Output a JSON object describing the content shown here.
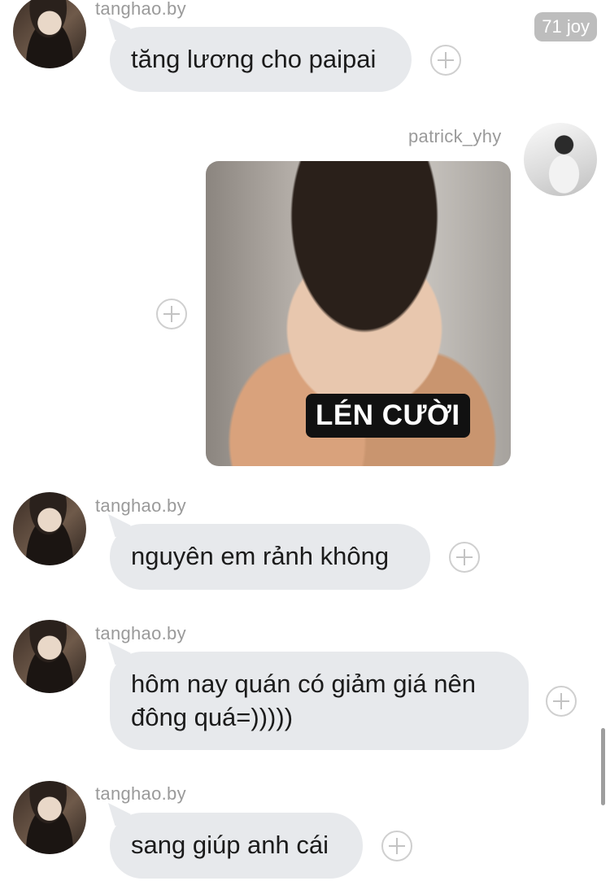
{
  "badge": "71 joy",
  "caption_text": "LÉN CƯỜI",
  "messages": [
    {
      "user": "tanghao.by",
      "text": "tăng lương cho paipai"
    },
    {
      "user": "patrick_yhy"
    },
    {
      "user": "tanghao.by",
      "text": "nguyên em rảnh không"
    },
    {
      "user": "tanghao.by",
      "text": "hôm nay quán có giảm giá nên đông quá=)))))"
    },
    {
      "user": "tanghao.by",
      "text": "sang giúp anh cái"
    }
  ]
}
